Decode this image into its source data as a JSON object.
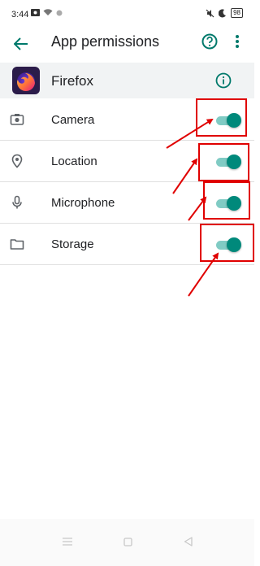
{
  "status_bar": {
    "time": "3:44",
    "battery": "98"
  },
  "app_bar": {
    "title": "App permissions"
  },
  "app": {
    "name": "Firefox"
  },
  "permissions": [
    {
      "label": "Camera",
      "icon": "camera-icon",
      "enabled": true
    },
    {
      "label": "Location",
      "icon": "location-pin-icon",
      "enabled": true
    },
    {
      "label": "Microphone",
      "icon": "microphone-icon",
      "enabled": true
    },
    {
      "label": "Storage",
      "icon": "folder-icon",
      "enabled": true
    }
  ],
  "colors": {
    "toggle_on_thumb": "#00897b",
    "toggle_on_track": "#80cbc4",
    "annotation": "#e00000",
    "app_row_background": "#f1f3f4"
  }
}
